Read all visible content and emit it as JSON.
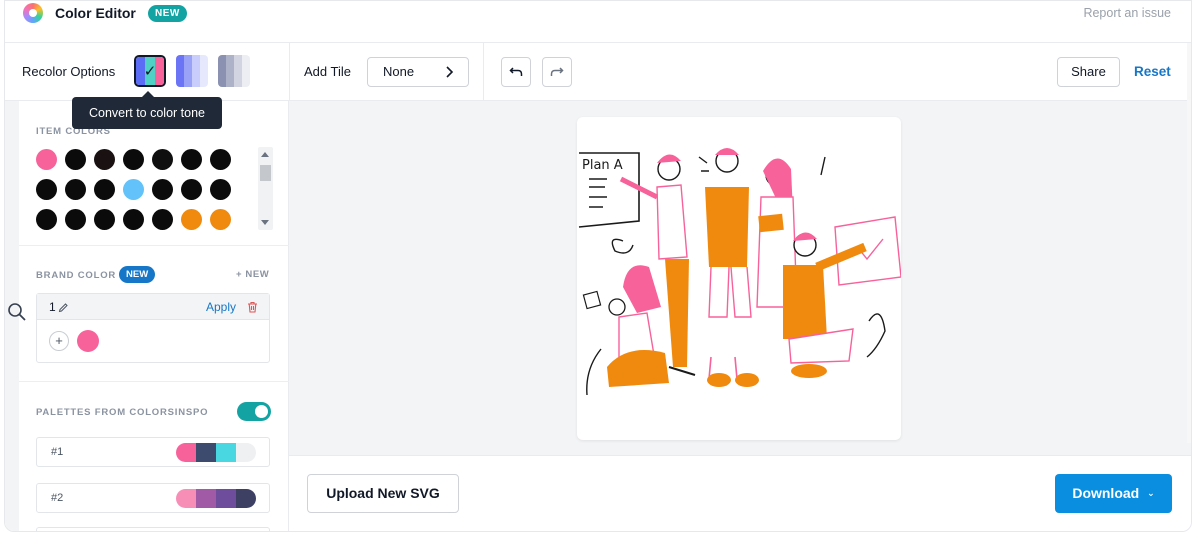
{
  "header": {
    "title": "Color Editor",
    "badge": "NEW",
    "report_link": "Report an issue"
  },
  "toolbar": {
    "recolor_label": "Recolor Options",
    "recolor_options": [
      {
        "name": "multicolor",
        "colors": [
          "#5b6cf5",
          "#4fd1c5",
          "#f7629a"
        ],
        "selected": true
      },
      {
        "name": "blue-tone",
        "colors": [
          "#6b74f5",
          "#9aa2f8",
          "#c9cdfb",
          "#e6e8fd"
        ],
        "selected": false
      },
      {
        "name": "gray-tone",
        "colors": [
          "#8b91b0",
          "#aeb2c8",
          "#d2d5e1",
          "#eceef3"
        ],
        "selected": false
      }
    ],
    "check_glyph": "✓",
    "tooltip": "Convert to color tone",
    "add_tile_label": "Add Tile",
    "tile_value": "None",
    "share_label": "Share",
    "reset_label": "Reset"
  },
  "sidebar": {
    "item_colors_title": "ITEM COLORS",
    "item_colors": [
      [
        "#f7629a",
        "#0b0b0b",
        "#1a1212",
        "#0b0b0b",
        "#0f0f0f",
        "#0b0b0b",
        "#0b0b0b"
      ],
      [
        "#0b0b0b",
        "#0b0b0b",
        "#0b0b0b",
        "#62c2f9",
        "#0b0b0b",
        "#0b0b0b",
        "#0b0b0b"
      ],
      [
        "#0b0b0b",
        "#0b0b0b",
        "#0b0b0b",
        "#0b0b0b",
        "#0b0b0b",
        "#f08a0f",
        "#f08a0f"
      ]
    ],
    "brand_color_title": "BRAND COLOR",
    "brand_badge": "NEW",
    "brand_add": "+ NEW",
    "brand_name": "1",
    "brand_apply": "Apply",
    "brand_plus": "+",
    "brand_color": "#f7629a",
    "palettes_title": "PALETTES FROM COLORSINSPO",
    "palettes": [
      {
        "label": "#1",
        "colors": [
          "#f7629a",
          "#3d4b6e",
          "#49d8e2",
          "#eef0f2"
        ]
      },
      {
        "label": "#2",
        "colors": [
          "#f78eb6",
          "#a15ba6",
          "#6e4d9c",
          "#3d3f63"
        ]
      }
    ]
  },
  "canvas": {
    "art_text": "Plan A",
    "accent_pink": "#f7629a",
    "accent_orange": "#f08a0f"
  },
  "bottom": {
    "upload_label": "Upload New SVG",
    "download_label": "Download",
    "download_caret": "⌄"
  }
}
